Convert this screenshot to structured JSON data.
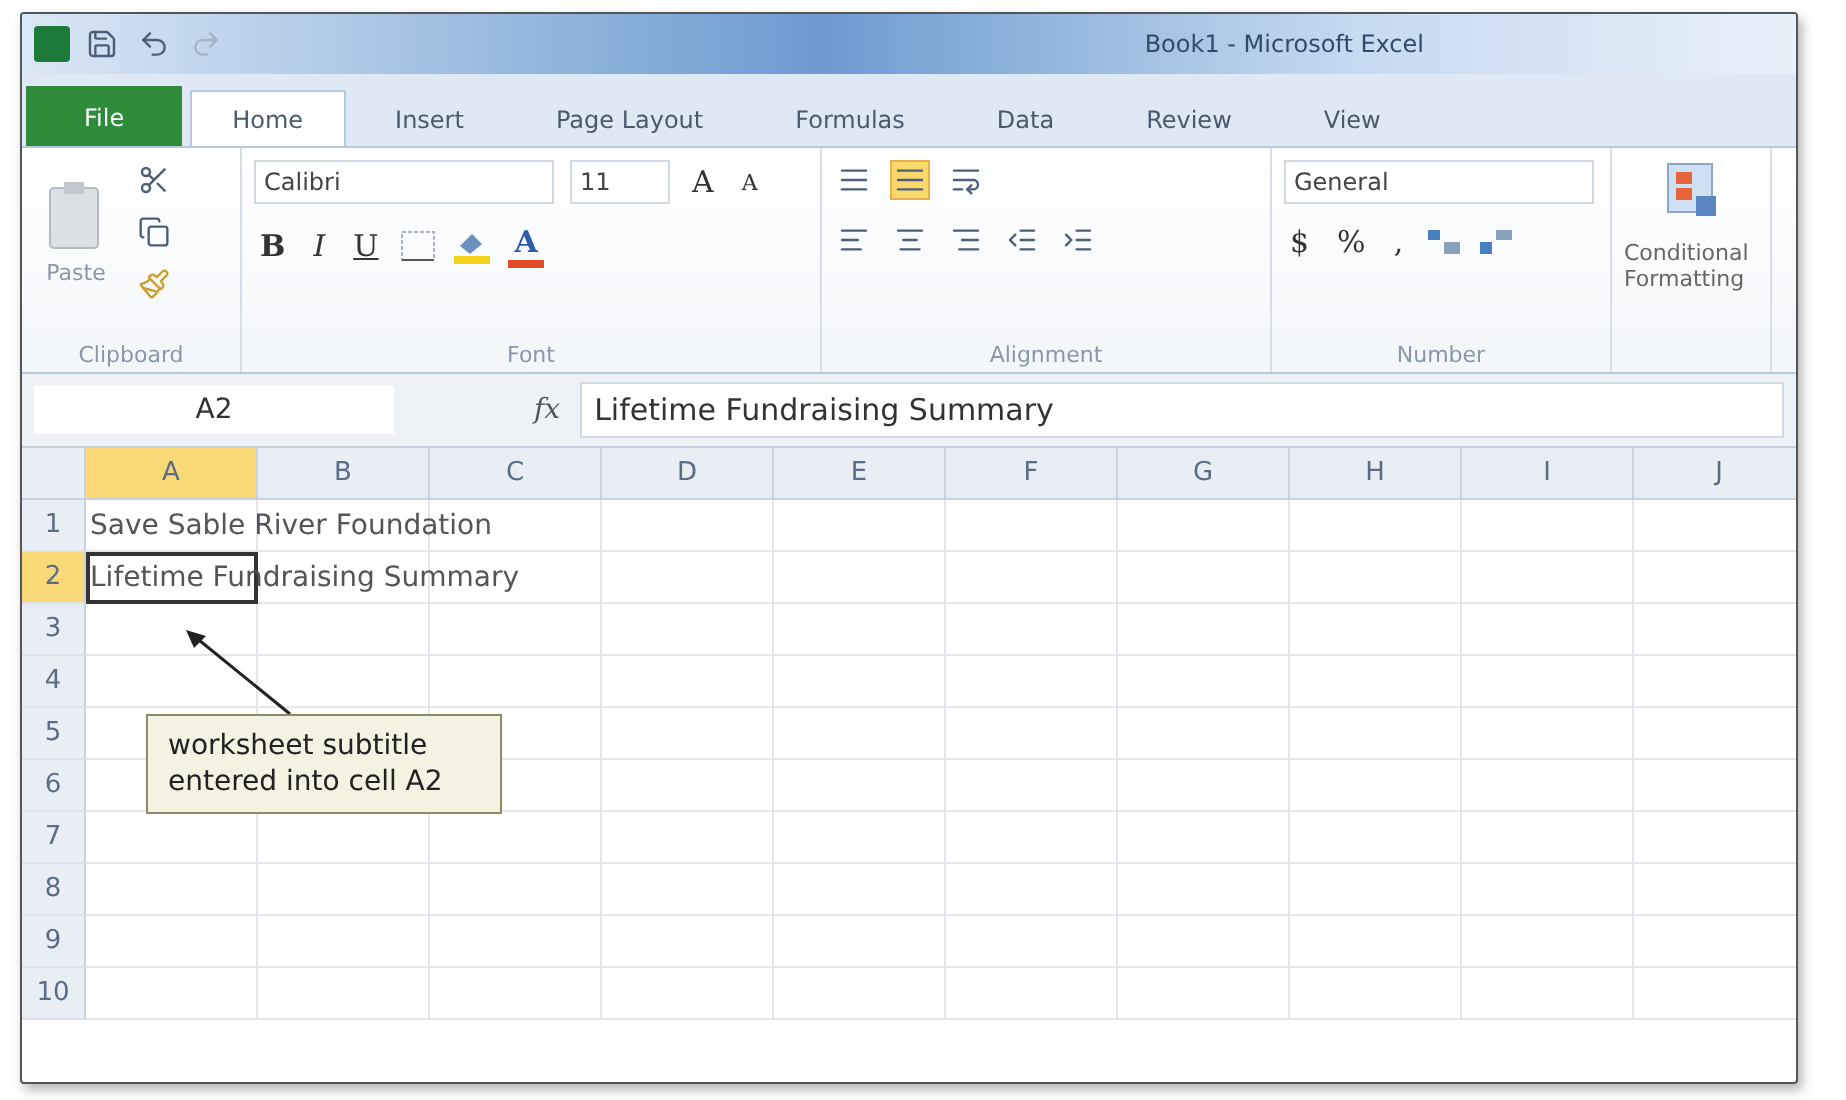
{
  "window": {
    "title": "Book1 - Microsoft Excel"
  },
  "tabs": [
    {
      "label": "File",
      "kind": "file",
      "selected": false
    },
    {
      "label": "Home",
      "kind": "tab",
      "selected": true
    },
    {
      "label": "Insert",
      "kind": "tab",
      "selected": false
    },
    {
      "label": "Page Layout",
      "kind": "tab",
      "selected": false
    },
    {
      "label": "Formulas",
      "kind": "tab",
      "selected": false
    },
    {
      "label": "Data",
      "kind": "tab",
      "selected": false
    },
    {
      "label": "Review",
      "kind": "tab",
      "selected": false
    },
    {
      "label": "View",
      "kind": "tab",
      "selected": false
    }
  ],
  "ribbon": {
    "clipboard": {
      "label": "Clipboard",
      "paste": "Paste"
    },
    "font": {
      "label": "Font",
      "name": "Calibri",
      "size": "11",
      "grow": "A",
      "shrink": "A",
      "bold": "B",
      "italic": "I",
      "underline": "U",
      "color_letter": "A"
    },
    "alignment": {
      "label": "Alignment",
      "middle_align_selected": true
    },
    "number": {
      "label": "Number",
      "format": "General",
      "currency": "$",
      "percent": "%",
      "comma": ","
    },
    "styles": {
      "conditional": "Conditional Formatting"
    }
  },
  "formula_bar": {
    "name_box": "A2",
    "fx": "fx",
    "value": "Lifetime Fundraising Summary"
  },
  "columns": [
    {
      "label": "A",
      "selected": true
    },
    {
      "label": "B",
      "selected": false
    },
    {
      "label": "C",
      "selected": false
    },
    {
      "label": "D",
      "selected": false
    },
    {
      "label": "E",
      "selected": false
    },
    {
      "label": "F",
      "selected": false
    },
    {
      "label": "G",
      "selected": false
    },
    {
      "label": "H",
      "selected": false
    },
    {
      "label": "I",
      "selected": false
    },
    {
      "label": "J",
      "selected": false
    }
  ],
  "rows": [
    {
      "header": "1",
      "selected": false,
      "text": "Save Sable River Foundation"
    },
    {
      "header": "2",
      "selected": true,
      "text": "Lifetime Fundraising Summary"
    },
    {
      "header": "3",
      "selected": false
    },
    {
      "header": "4",
      "selected": false
    },
    {
      "header": "5",
      "selected": false
    },
    {
      "header": "6",
      "selected": false
    },
    {
      "header": "7",
      "selected": false
    },
    {
      "header": "8",
      "selected": false
    },
    {
      "header": "9",
      "selected": false
    },
    {
      "header": "10",
      "selected": false
    }
  ],
  "callout": "worksheet subtitle entered into cell A2"
}
